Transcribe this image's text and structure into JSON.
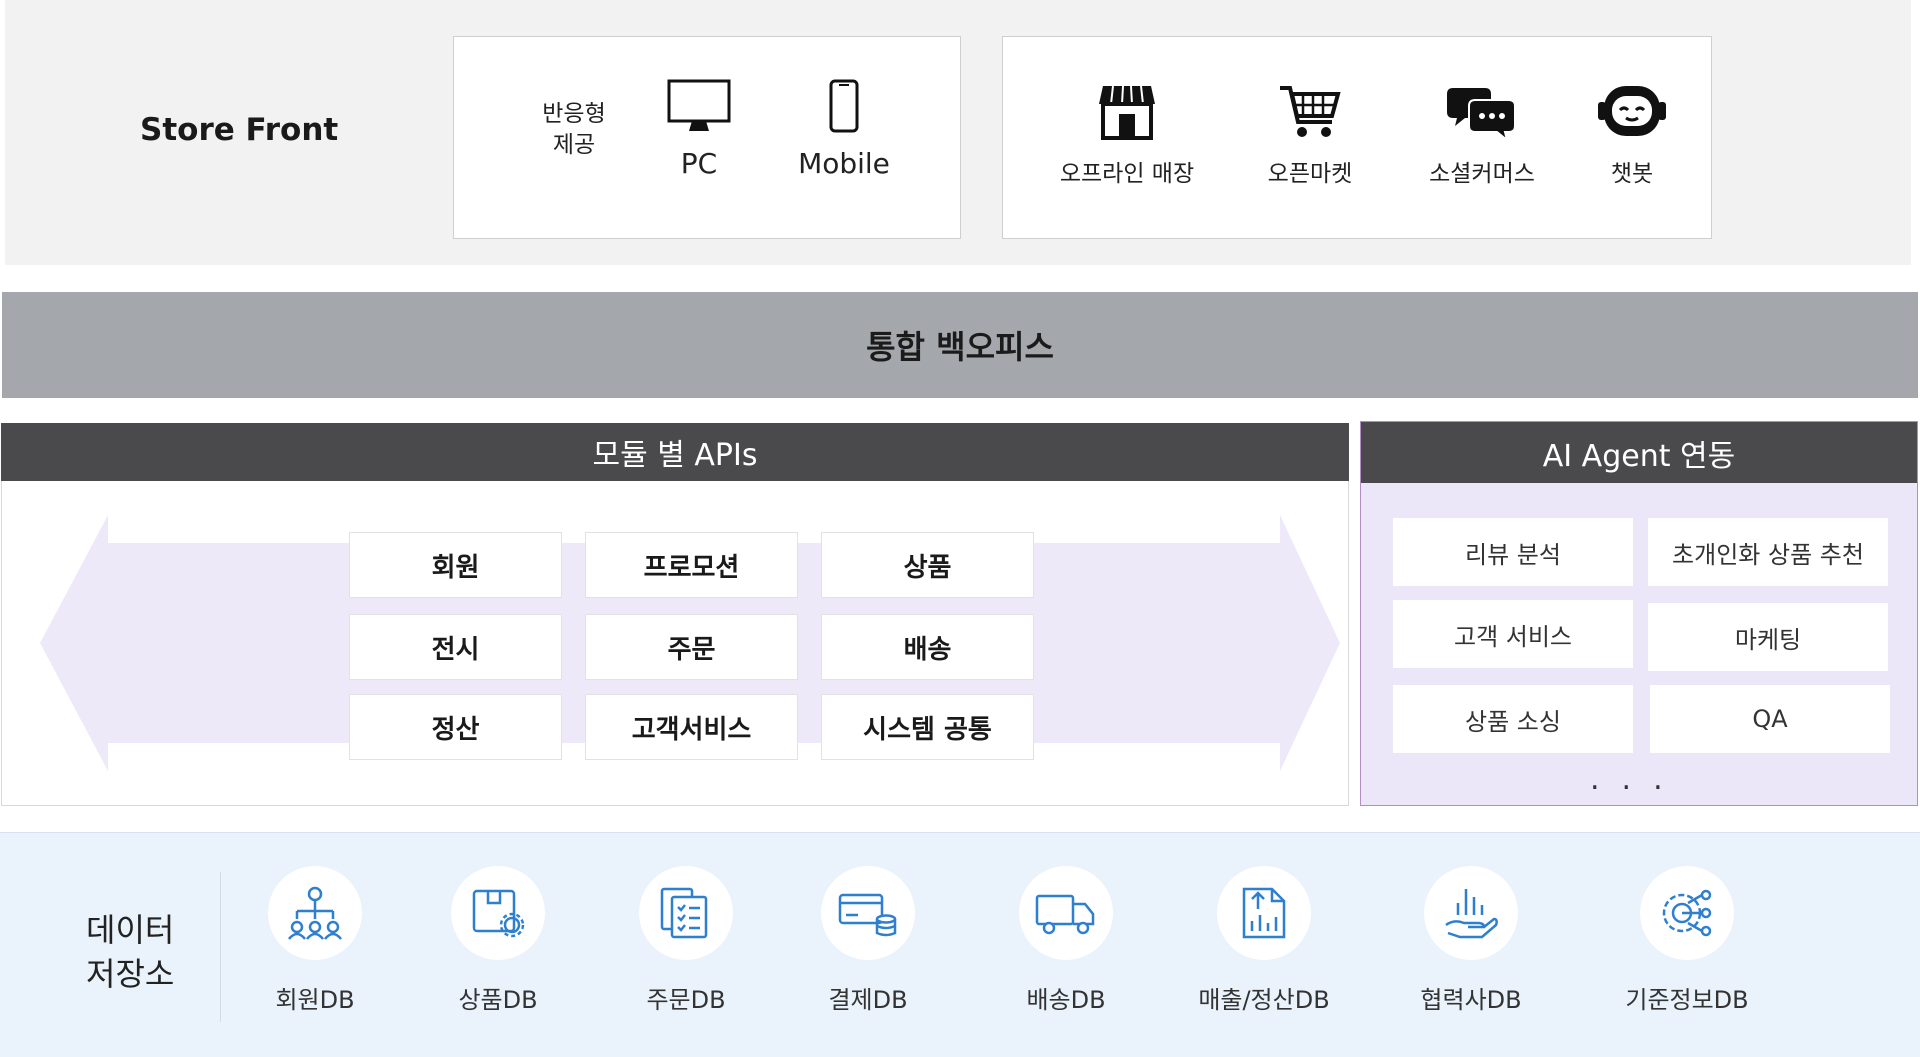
{
  "store_front": {
    "title": "Store Front",
    "responsive_label": "반응형\n제공",
    "devices": [
      {
        "label": "PC",
        "icon": "monitor-icon"
      },
      {
        "label": "Mobile",
        "icon": "smartphone-icon"
      }
    ],
    "channels": [
      {
        "label": "오프라인 매장",
        "icon": "store-icon"
      },
      {
        "label": "오픈마켓",
        "icon": "shopping-cart-icon"
      },
      {
        "label": "소셜커머스",
        "icon": "chat-bubbles-icon"
      },
      {
        "label": "챗봇",
        "icon": "chatbot-icon"
      }
    ]
  },
  "back_office": {
    "title": "통합 백오피스"
  },
  "module_apis": {
    "title": "모듈 별 APIs",
    "modules": [
      [
        "회원",
        "프로모션",
        "상품"
      ],
      [
        "전시",
        "주문",
        "배송"
      ],
      [
        "정산",
        "고객서비스",
        "시스템 공통"
      ]
    ]
  },
  "ai_agent": {
    "title": "AI Agent 연동",
    "items": [
      [
        "리뷰 분석",
        "초개인화 상품 추천"
      ],
      [
        "고객 서비스",
        "마케팅"
      ],
      [
        "상품 소싱",
        "QA"
      ]
    ],
    "more": "..."
  },
  "data_storage": {
    "title": "데이터\n저장소",
    "databases": [
      {
        "label": "회원DB",
        "icon": "org-chart-icon"
      },
      {
        "label": "상품DB",
        "icon": "box-gear-icon"
      },
      {
        "label": "주문DB",
        "icon": "order-list-icon"
      },
      {
        "label": "결제DB",
        "icon": "payment-card-icon"
      },
      {
        "label": "배송DB",
        "icon": "delivery-truck-icon"
      },
      {
        "label": "매출/정산DB",
        "icon": "sales-report-icon"
      },
      {
        "label": "협력사DB",
        "icon": "partner-hand-icon"
      },
      {
        "label": "기준정보DB",
        "icon": "settings-network-icon"
      }
    ]
  },
  "colors": {
    "back_office": "#a4a7ab",
    "header_dark": "#4a4a4c",
    "ai_bg": "#ece6f9",
    "db_bg": "#eaf2fb",
    "db_icon": "#2f7fcf",
    "arrow": "#ede9f9"
  }
}
